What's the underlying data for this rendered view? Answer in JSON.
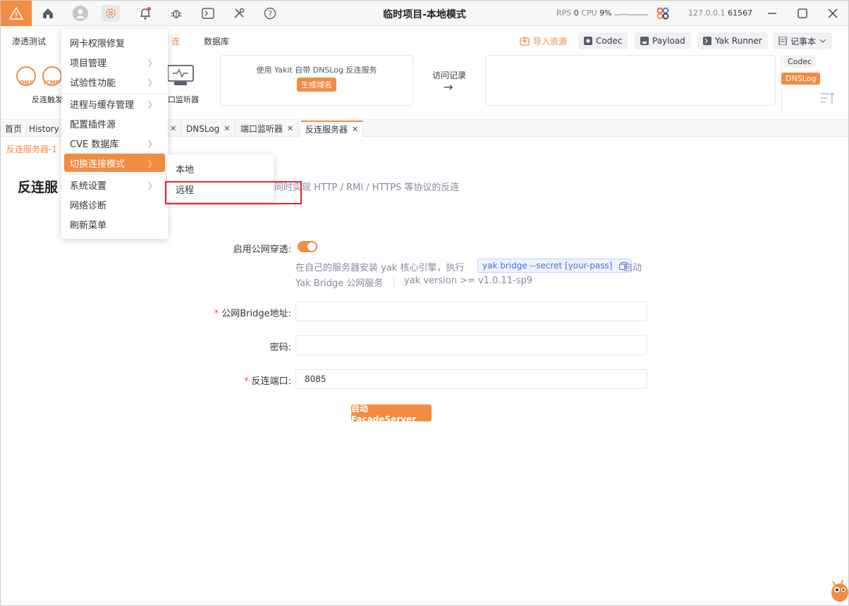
{
  "title_bar": {
    "title": "临时项目-本地模式",
    "rps_label": "RPS",
    "rps_value": "0",
    "cpu_label": "CPU",
    "cpu_value": "9%",
    "address": "127.0.0.1",
    "port": "61567",
    "icons": [
      "warning-icon",
      "home-icon",
      "user-icon",
      "gear-icon",
      "bell-icon",
      "bug-icon",
      "terminal-icon",
      "tools-icon",
      "help-icon"
    ]
  },
  "menu_bar": {
    "pentest": "渗透测试",
    "reverse_suffix": "连",
    "database": "数据库",
    "import_resource": "导入资源",
    "codec": "Codec",
    "payload": "Payload",
    "yak_runner": "Yak Runner",
    "notebook": "记事本"
  },
  "toolbar": {
    "dns_label": "DNS",
    "icmp_label": "ICMP",
    "reverse_trigger": "反连触发",
    "port_listener": "口监听器",
    "dnslog_desc": "使用 Yakit 自带 DNSLog 反连服务",
    "generate_domain": "生成域名",
    "visit_record": "访问记录",
    "arrow": "→",
    "tag_codec": "Codec",
    "tag_dnslog": "DNSLog"
  },
  "tabs": [
    {
      "label": "首页"
    },
    {
      "label": "History"
    },
    {
      "label": "DNSLog"
    },
    {
      "label": "端口监听器"
    },
    {
      "label": "反连服务器"
    }
  ],
  "subtab": "反连服务器-1",
  "page": {
    "heading": "反连服",
    "description": "同时实现 HTTP / RMI / HTTPS 等协议的反连"
  },
  "form": {
    "public_penetration_label": "启用公网穿透:",
    "help_line1": "在自己的服务器安装 yak 核心引擎，执行",
    "code": "yak bridge --secret [your-pass]",
    "help_start": "启动",
    "help_line2": "Yak Bridge 公网服务",
    "version_hint": "yak version >= v1.0.11-sp9",
    "bridge_address_label": "公网Bridge地址:",
    "bridge_address_value": "",
    "password_label": "密码:",
    "password_value": "",
    "port_label": "反连端口:",
    "port_value": "8085",
    "submit": "启动FacadeServer"
  },
  "dropdown": {
    "items": [
      {
        "label": "网卡权限修复",
        "submenu": false
      },
      {
        "label": "项目管理",
        "submenu": true
      },
      {
        "label": "试验性功能",
        "submenu": true
      },
      {
        "label": "进程与缓存管理",
        "submenu": true
      },
      {
        "label": "配置插件源",
        "submenu": false
      },
      {
        "label": "CVE 数据库",
        "submenu": true
      },
      {
        "label": "切换连接模式",
        "submenu": true
      },
      {
        "label": "系统设置",
        "submenu": true
      },
      {
        "label": "网络诊断",
        "submenu": false
      },
      {
        "label": "刷新菜单",
        "submenu": false
      }
    ],
    "submenu_items": [
      {
        "label": "本地"
      },
      {
        "label": "远程"
      }
    ]
  },
  "colors": {
    "accent": "#f28b44",
    "highlight": "#e5232b"
  }
}
